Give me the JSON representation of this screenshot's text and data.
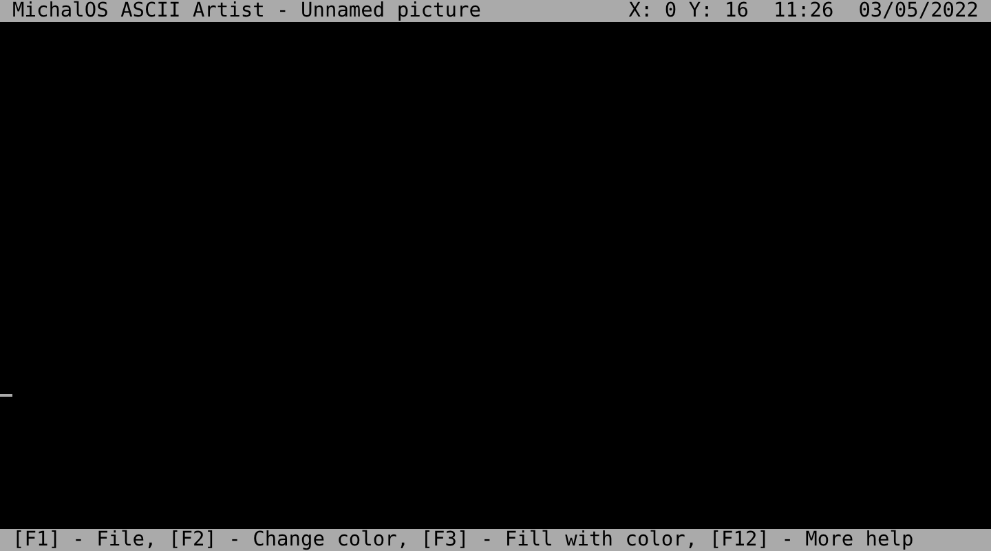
{
  "title_bar": {
    "title": "MichalOS ASCII Artist - Unnamed picture",
    "position": "X: 0 Y: 16",
    "time": "11:26",
    "date": "03/05/2022"
  },
  "help_bar": {
    "text": "[F1] - File, [F2] - Change color, [F3] - Fill with color, [F12] - More help"
  }
}
